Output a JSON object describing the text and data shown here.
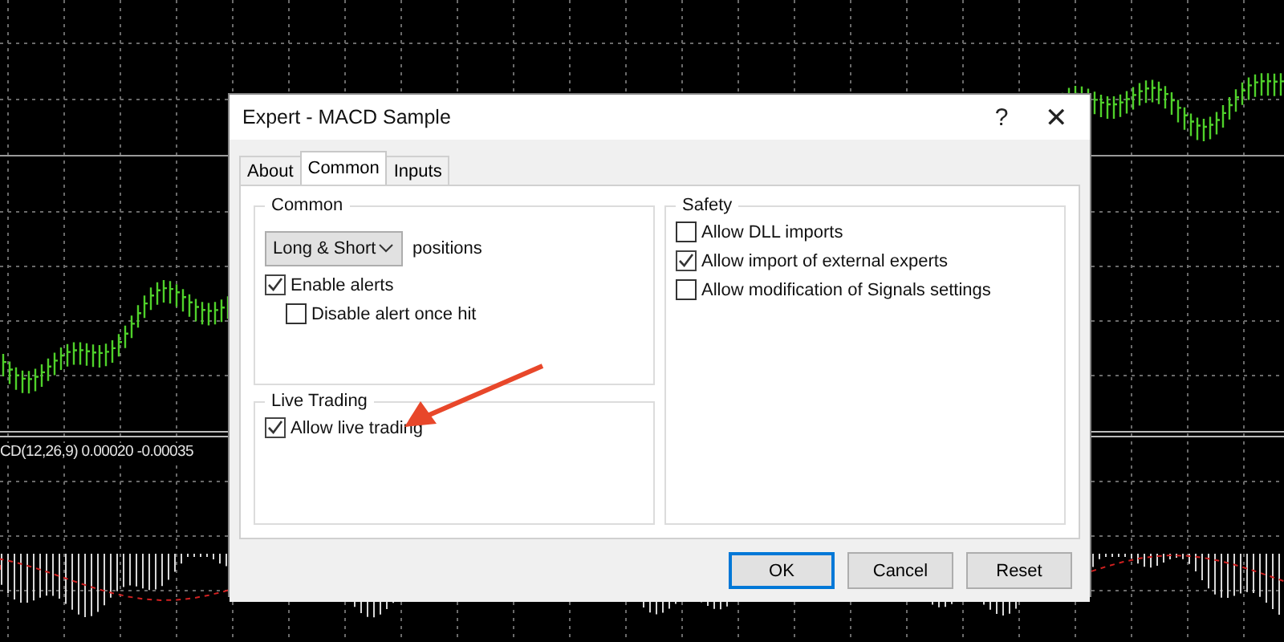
{
  "chart": {
    "indicator_label": "CD(12,26,9) 0.00020 -0.00035"
  },
  "window": {
    "title": "Expert - MACD Sample",
    "help_label": "?",
    "close_label": "✕"
  },
  "tabs": [
    {
      "label": "About",
      "selected": false
    },
    {
      "label": "Common",
      "selected": true
    },
    {
      "label": "Inputs",
      "selected": false
    }
  ],
  "columns": [
    {
      "groups": [
        {
          "title": "Common",
          "items": [
            {
              "kind": "dropdown",
              "value": "Long & Short",
              "suffix": "positions"
            },
            {
              "kind": "checkbox",
              "label": "Enable alerts",
              "checked": true,
              "children": [
                {
                  "label": "Disable alert once hit",
                  "checked": false
                }
              ]
            }
          ]
        },
        {
          "title": "Live Trading",
          "items": [
            {
              "kind": "checkbox",
              "label": "Allow live trading",
              "checked": true
            }
          ]
        }
      ]
    },
    {
      "groups": [
        {
          "title": "Safety",
          "items": [
            {
              "kind": "checkbox",
              "label": "Allow DLL imports",
              "checked": false
            },
            {
              "kind": "checkbox",
              "label": "Allow import of external experts",
              "checked": true
            },
            {
              "kind": "checkbox",
              "label": "Allow modification of Signals settings",
              "checked": false
            }
          ]
        }
      ]
    }
  ],
  "buttons": [
    {
      "label": "OK",
      "default": true
    },
    {
      "label": "Cancel",
      "default": false
    },
    {
      "label": "Reset",
      "default": false
    }
  ]
}
